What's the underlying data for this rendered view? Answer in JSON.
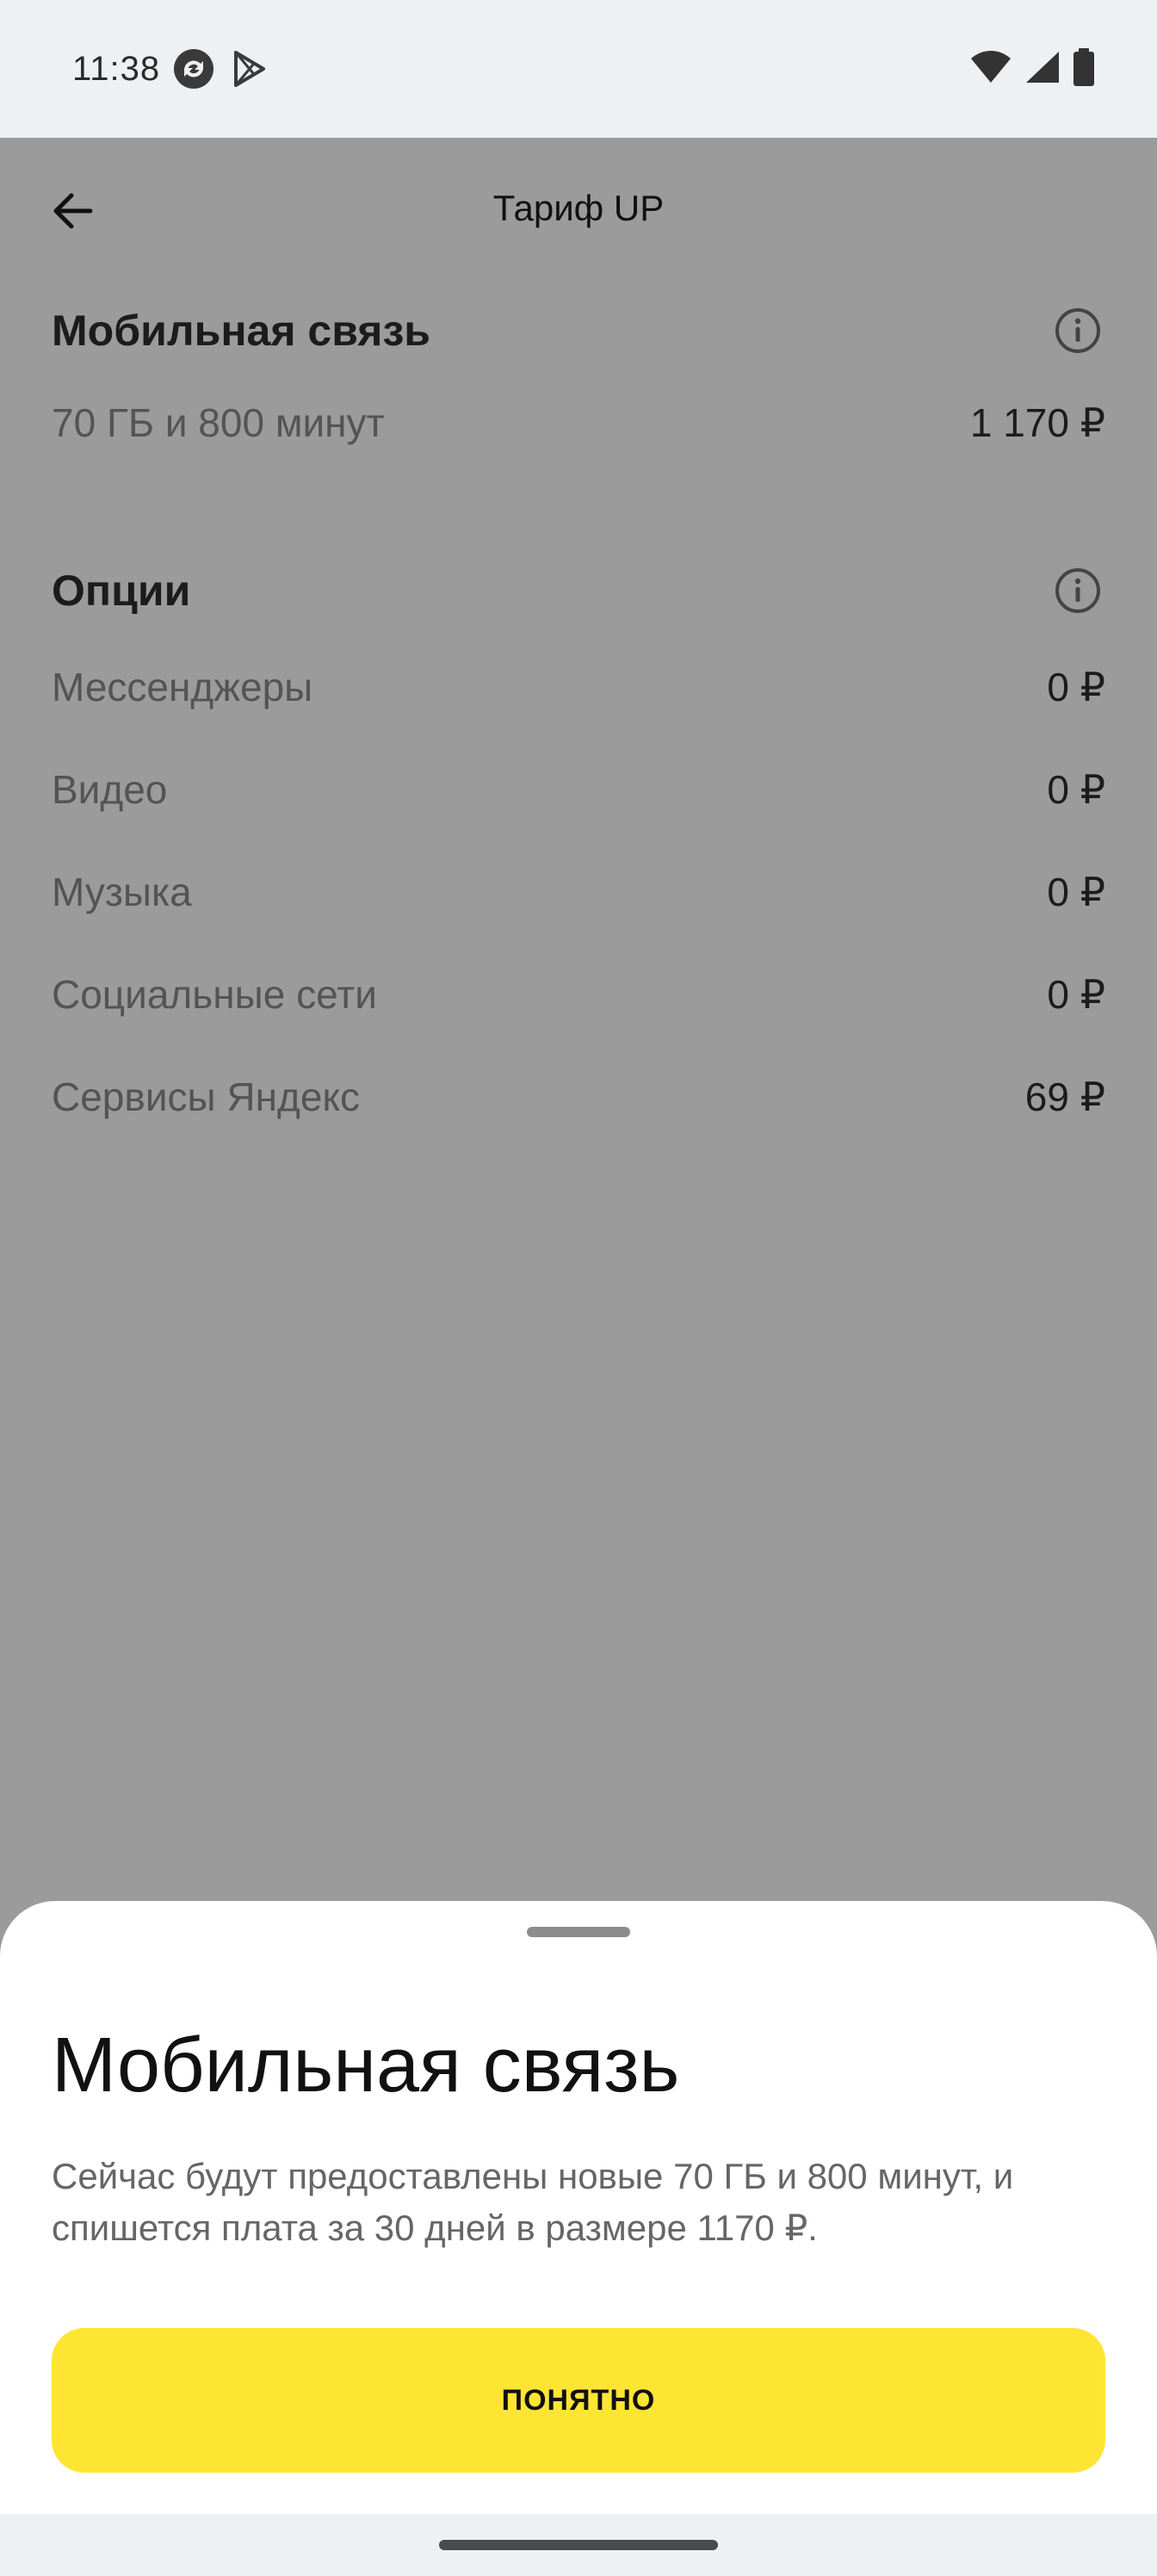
{
  "status_bar": {
    "time": "11:38",
    "icons_left": [
      "sync-icon",
      "play-store-icon"
    ],
    "icons_right": [
      "wifi-icon",
      "cellular-signal-icon",
      "battery-icon"
    ]
  },
  "app_bar": {
    "title": "Тариф UP",
    "back_icon": "arrow-left-icon"
  },
  "mobile_section": {
    "title": "Мобильная связь",
    "rows": [
      {
        "label": "70 ГБ и 800 минут",
        "value": "1 170 ₽"
      }
    ]
  },
  "options_section": {
    "title": "Опции",
    "rows": [
      {
        "label": "Мессенджеры",
        "value": "0 ₽"
      },
      {
        "label": "Видео",
        "value": "0 ₽"
      },
      {
        "label": "Музыка",
        "value": "0 ₽"
      },
      {
        "label": "Социальные сети",
        "value": "0 ₽"
      },
      {
        "label": "Сервисы Яндекс",
        "value": "69 ₽"
      }
    ]
  },
  "sheet": {
    "title": "Мобильная связь",
    "text": "Сейчас будут предоставлены новые 70 ГБ и 800 минут, и спишется плата за 30 дней в размере 1170 ₽.",
    "button_label": "ПОНЯТНО"
  },
  "colors": {
    "scrim": "#9b9b9b",
    "status_bar": "#eef1f4",
    "accent_button": "#ffe533",
    "sheet_bg": "#ffffff"
  }
}
